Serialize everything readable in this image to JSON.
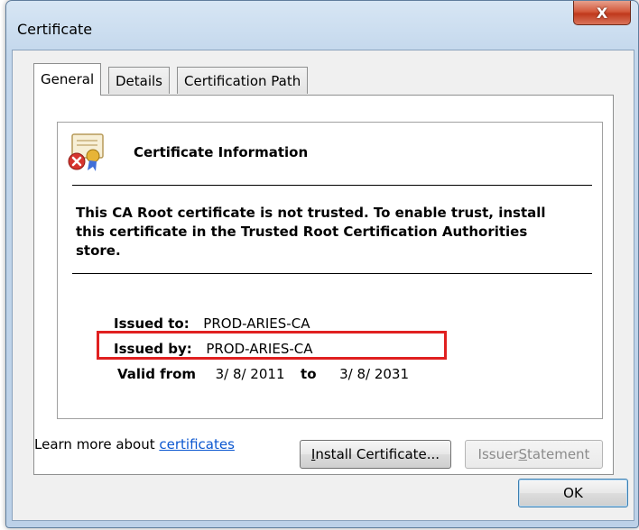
{
  "window": {
    "title": "Certificate",
    "close_label": "X"
  },
  "tabs": [
    {
      "label": "General",
      "active": true
    },
    {
      "label": "Details",
      "active": false
    },
    {
      "label": "Certification Path",
      "active": false
    }
  ],
  "info": {
    "heading": "Certificate Information",
    "warning": "This CA Root certificate is not trusted. To enable trust, install this certificate in the Trusted Root Certification Authorities store.",
    "issued_to_label": "Issued to:",
    "issued_to_value": "PROD-ARIES-CA",
    "issued_by_label": "Issued by:",
    "issued_by_value": "PROD-ARIES-CA",
    "valid_from_label": "Valid from",
    "valid_from_value": "3/ 8/ 2011",
    "valid_to_label": "to",
    "valid_to_value": "3/ 8/ 2031"
  },
  "buttons": {
    "install_pre": "I",
    "install_rest": "nstall Certificate...",
    "issuer_pre": "Issuer ",
    "issuer_mn": "S",
    "issuer_rest": "tatement",
    "ok": "OK"
  },
  "learn_more": {
    "text": "Learn more about ",
    "link": "certificates"
  },
  "colors": {
    "highlight_box": "#e02020",
    "link": "#0b57d0"
  }
}
